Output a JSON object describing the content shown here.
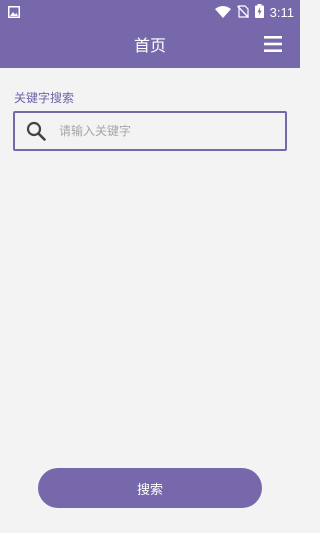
{
  "status_bar": {
    "time": "3:11",
    "icons": [
      "gallery-notification-icon",
      "wifi-icon",
      "no-sim-icon",
      "battery-charging-icon"
    ]
  },
  "header": {
    "title": "首页",
    "menu_icon": "menu-icon"
  },
  "search": {
    "label": "关键字搜索",
    "placeholder": "请输入关键字",
    "value": "",
    "icon": "search-icon"
  },
  "footer": {
    "search_button_label": "搜索"
  },
  "colors": {
    "accent": "#7768ac",
    "background": "#f3f3f4",
    "label": "#6e63a8",
    "placeholder": "#a6a6a6"
  }
}
